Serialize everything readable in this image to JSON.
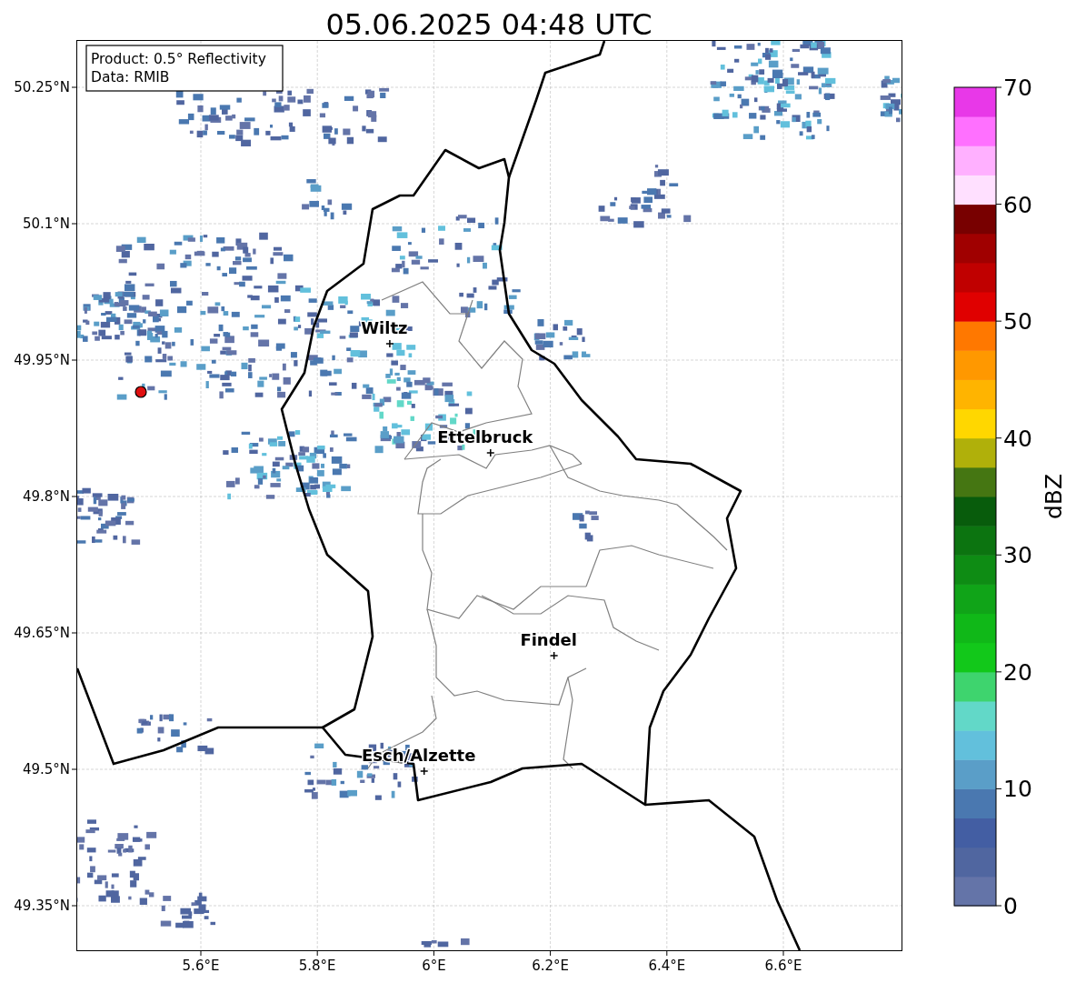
{
  "title": "05.06.2025 04:48 UTC",
  "info_box": [
    "Product: 0.5° Reflectivity",
    "Data: RMIB"
  ],
  "y_ticks": [
    "50.25°N",
    "50.1°N",
    "49.95°N",
    "49.8°N",
    "49.65°N",
    "49.5°N",
    "49.35°N"
  ],
  "x_ticks": [
    "5.6°E",
    "5.8°E",
    "6°E",
    "6.2°E",
    "6.4°E",
    "6.6°E"
  ],
  "places": [
    {
      "name": "Wiltz"
    },
    {
      "name": "Ettelbruck"
    },
    {
      "name": "Findel"
    },
    {
      "name": "Esch/Alzette"
    }
  ],
  "colorbar": {
    "label": "dBZ",
    "ticks": [
      "70",
      "60",
      "50",
      "40",
      "30",
      "20",
      "10",
      "0"
    ],
    "bins": [
      {
        "color": "#6474a8"
      },
      {
        "color": "#5066a0"
      },
      {
        "color": "#435ea3"
      },
      {
        "color": "#4a78b0"
      },
      {
        "color": "#5a9ec8"
      },
      {
        "color": "#62c0dc"
      },
      {
        "color": "#62d8c8"
      },
      {
        "color": "#3ed46e"
      },
      {
        "color": "#12c81a"
      },
      {
        "color": "#10b818"
      },
      {
        "color": "#10a418"
      },
      {
        "color": "#0e8c14"
      },
      {
        "color": "#0c7410"
      },
      {
        "color": "#085c0c"
      },
      {
        "color": "#457612"
      },
      {
        "color": "#b0b00a"
      },
      {
        "color": "#ffd700"
      },
      {
        "color": "#ffb400"
      },
      {
        "color": "#ff9800"
      },
      {
        "color": "#ff7800"
      },
      {
        "color": "#e00000"
      },
      {
        "color": "#c00000"
      },
      {
        "color": "#a00000"
      },
      {
        "color": "#780000"
      },
      {
        "color": "#ffe0ff"
      },
      {
        "color": "#ffb0ff"
      },
      {
        "color": "#ff70ff"
      },
      {
        "color": "#e838e8"
      }
    ]
  }
}
